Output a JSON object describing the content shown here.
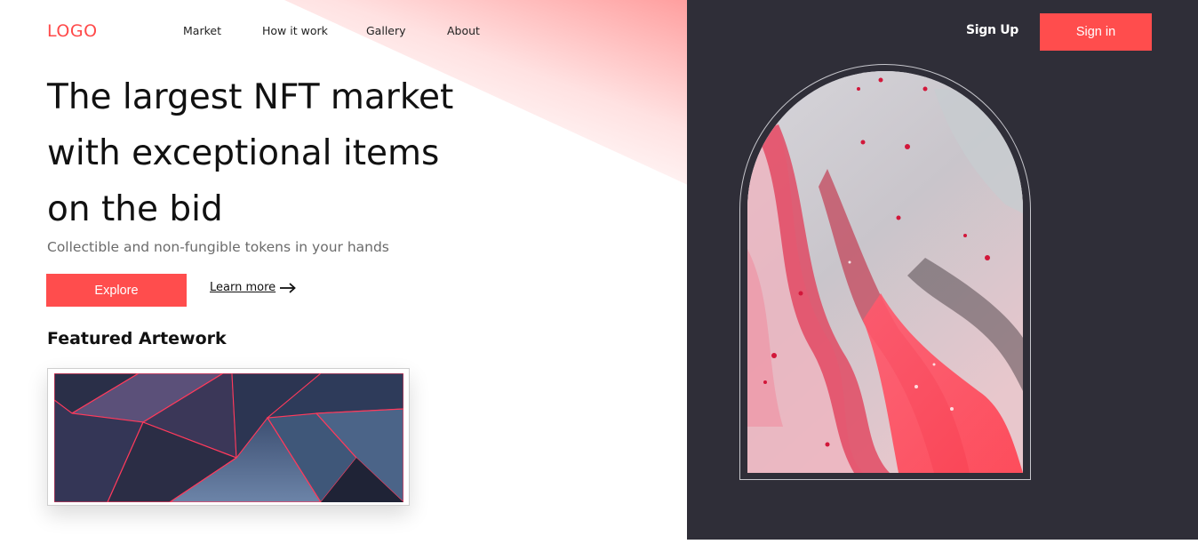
{
  "brand": {
    "logo_text": "LOGO",
    "accent_color": "#ff4d4d",
    "panel_color": "#2f2e38"
  },
  "nav": {
    "items": [
      {
        "label": "Market"
      },
      {
        "label": "How it work"
      },
      {
        "label": "Gallery"
      },
      {
        "label": "About"
      }
    ]
  },
  "auth": {
    "signup_label": "Sign Up",
    "signin_label": "Sign in"
  },
  "hero": {
    "headline_lines": [
      "The largest NFT market",
      "with exceptional items",
      "on the bid"
    ],
    "subtitle": "Collectible and non-fungible tokens in your hands",
    "explore_label": "Explore",
    "learn_more_label": "Learn more",
    "learn_more_icon": "arrow-right-icon"
  },
  "featured": {
    "title": "Featured Artework"
  },
  "images": {
    "featured_art": "abstract geometric dark blue polygons with red edges",
    "hero_art": "fluid pink red grey marbled abstract painting"
  }
}
